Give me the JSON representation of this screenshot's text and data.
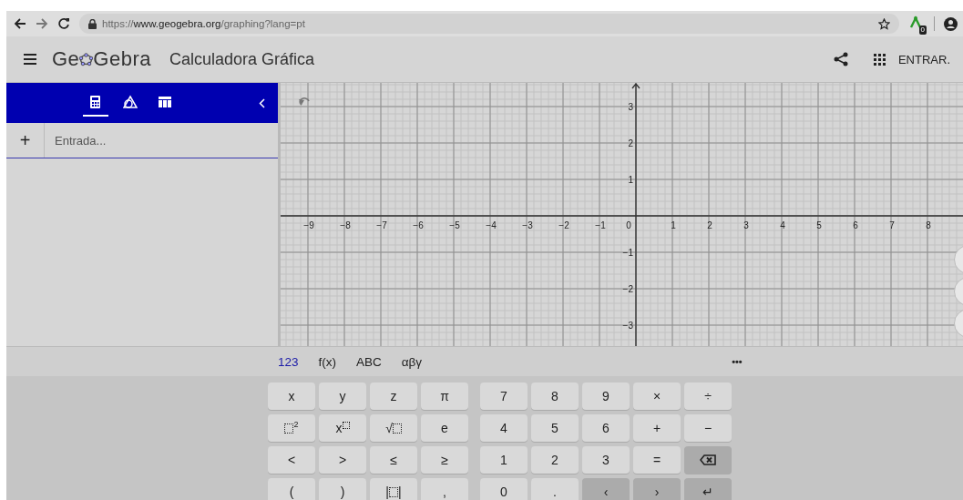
{
  "browser": {
    "url_scheme": "https://",
    "url_host": "www.geogebra.org",
    "url_path": "/graphing?lang=pt",
    "extension_badge": "0"
  },
  "header": {
    "logo_start": "Ge",
    "logo_end": "Gebra",
    "title": "Calculadora Gráfica",
    "sign_in": "ENTRAR."
  },
  "sidebar": {
    "tabs": [
      {
        "kind": "algebra",
        "selected": true
      },
      {
        "kind": "tools",
        "selected": false
      },
      {
        "kind": "table",
        "selected": false
      }
    ],
    "input": {
      "add_symbol": "+",
      "placeholder": "Entrada..."
    }
  },
  "graph": {
    "x_labels": [
      "−9",
      "−8",
      "−7",
      "−6",
      "−5",
      "−4",
      "−3",
      "−2",
      "−1",
      "0",
      "1",
      "2",
      "3",
      "4",
      "5",
      "6",
      "7",
      "8"
    ],
    "y_labels": [
      "3",
      "2",
      "1",
      "−1",
      "−2",
      "−3"
    ]
  },
  "keyboard": {
    "tabs": [
      {
        "label": "123",
        "selected": true
      },
      {
        "label": "f(x)",
        "selected": false
      },
      {
        "label": "ABC",
        "selected": false
      },
      {
        "label": "αβγ",
        "selected": false
      }
    ],
    "more": "•••",
    "left_keys": [
      [
        {
          "kind": "text",
          "label": "x"
        },
        {
          "kind": "text",
          "label": "y"
        },
        {
          "kind": "text",
          "label": "z"
        },
        {
          "kind": "text",
          "label": "π"
        }
      ],
      [
        {
          "kind": "square",
          "label": "2"
        },
        {
          "kind": "power",
          "label": "x"
        },
        {
          "kind": "sqrt",
          "label": "√"
        },
        {
          "kind": "text",
          "label": "e"
        }
      ],
      [
        {
          "kind": "text",
          "label": "<"
        },
        {
          "kind": "text",
          "label": ">"
        },
        {
          "kind": "text",
          "label": "≤"
        },
        {
          "kind": "text",
          "label": "≥"
        }
      ],
      [
        {
          "kind": "text",
          "label": "("
        },
        {
          "kind": "text",
          "label": ")"
        },
        {
          "kind": "abs",
          "label": "|"
        },
        {
          "kind": "text",
          "label": ","
        }
      ]
    ],
    "right_keys": [
      [
        {
          "kind": "text",
          "label": "7"
        },
        {
          "kind": "text",
          "label": "8"
        },
        {
          "kind": "text",
          "label": "9"
        },
        {
          "kind": "text",
          "label": "×"
        },
        {
          "kind": "text",
          "label": "÷"
        }
      ],
      [
        {
          "kind": "text",
          "label": "4"
        },
        {
          "kind": "text",
          "label": "5"
        },
        {
          "kind": "text",
          "label": "6"
        },
        {
          "kind": "text",
          "label": "+"
        },
        {
          "kind": "text",
          "label": "−"
        }
      ],
      [
        {
          "kind": "text",
          "label": "1"
        },
        {
          "kind": "text",
          "label": "2"
        },
        {
          "kind": "text",
          "label": "3"
        },
        {
          "kind": "text",
          "label": "="
        },
        {
          "kind": "backspace"
        }
      ],
      [
        {
          "kind": "text",
          "label": "0"
        },
        {
          "kind": "text",
          "label": "."
        },
        {
          "kind": "arrow",
          "label": "‹"
        },
        {
          "kind": "arrow",
          "label": "›"
        },
        {
          "kind": "enter",
          "label": "↵"
        }
      ]
    ]
  }
}
